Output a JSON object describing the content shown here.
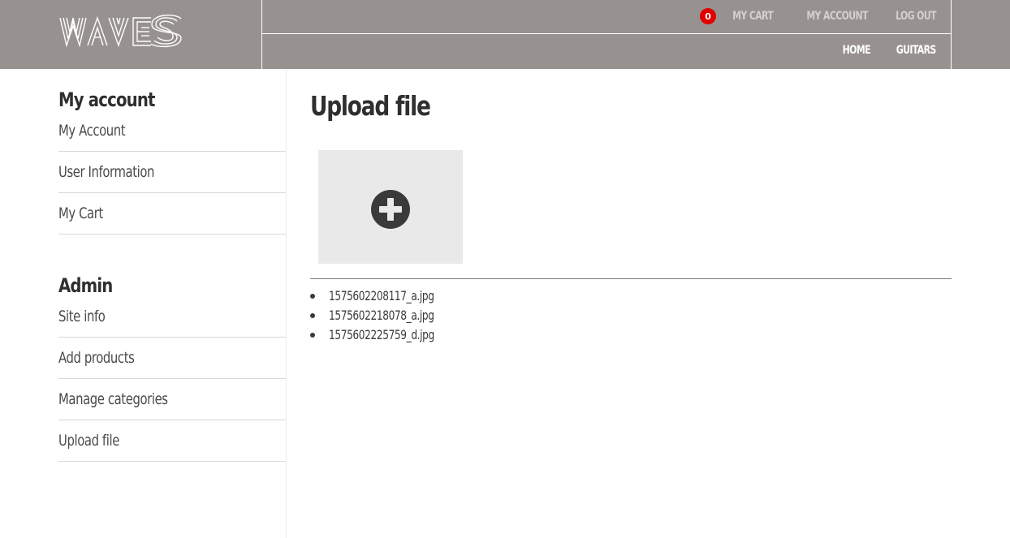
{
  "header": {
    "logo_text": "WAVES",
    "cart_count": "0",
    "top_links": [
      "MY CART",
      "MY ACCOUNT",
      "LOG OUT"
    ],
    "bottom_links": [
      "HOME",
      "GUITARS"
    ]
  },
  "sidebar": {
    "account_heading": "My account",
    "account_items": [
      "My Account",
      "User Information",
      "My Cart"
    ],
    "admin_heading": "Admin",
    "admin_items": [
      "Site info",
      "Add products",
      "Manage categories",
      "Upload file"
    ]
  },
  "main": {
    "title": "Upload file",
    "dropzone_icon": "plus-circle-icon",
    "files": [
      "1575602208117_a.jpg",
      "1575602218078_a.jpg",
      "1575602225759_d.jpg"
    ]
  },
  "colors": {
    "header_bg": "#97928f",
    "badge": "#e00000",
    "dropzone_bg": "#e9e9e9"
  }
}
